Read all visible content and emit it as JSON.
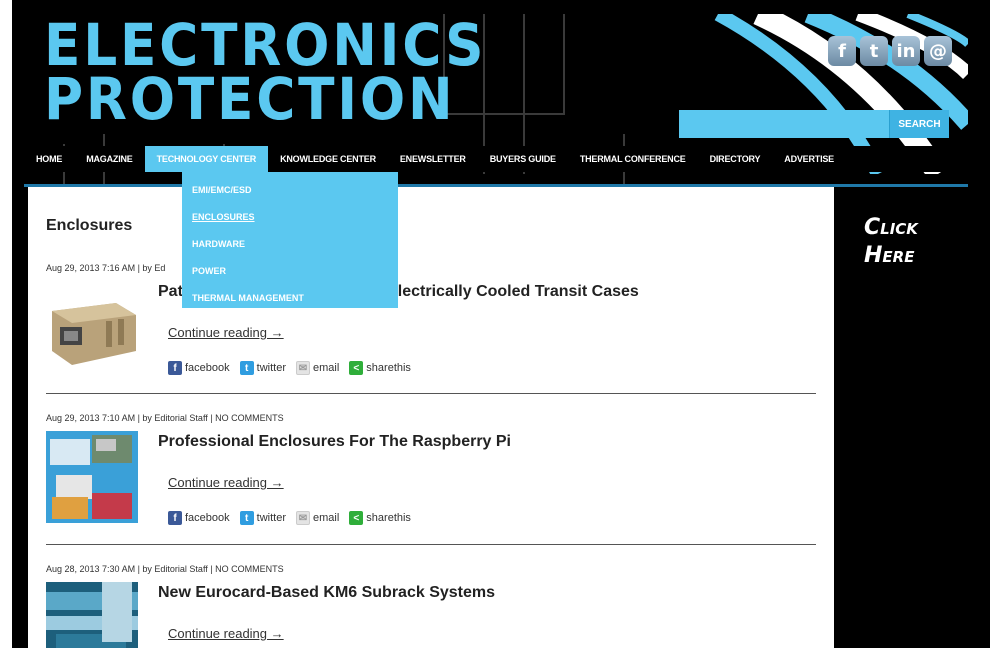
{
  "logo": {
    "line1": "ELECTRONICS",
    "line2": "PROTECTION"
  },
  "social": [
    {
      "icon": "facebook-icon",
      "glyph": "f"
    },
    {
      "icon": "twitter-icon",
      "glyph": "t"
    },
    {
      "icon": "linkedin-icon",
      "glyph": "in"
    },
    {
      "icon": "email-icon",
      "glyph": "@"
    }
  ],
  "search": {
    "placeholder": "",
    "button": "SEARCH"
  },
  "nav": [
    "HOME",
    "MAGAZINE",
    "TECHNOLOGY CENTER",
    "KNOWLEDGE CENTER",
    "ENEWSLETTER",
    "BUYERS GUIDE",
    "THERMAL CONFERENCE",
    "DIRECTORY",
    "ADVERTISE"
  ],
  "dropdown": [
    "EMI/EMC/ESD",
    "ENCLOSURES",
    "HARDWARE",
    "POWER",
    "THERMAL MANAGEMENT"
  ],
  "page_title": "Enclosures",
  "posts": [
    {
      "meta": "Aug 29, 2013 7:16 AM | by Ed",
      "title_left": "Pat",
      "title_right": "electrically Cooled Transit Cases",
      "continue": "Continue reading →"
    },
    {
      "meta": "Aug 29, 2013 7:10 AM | by Editorial Staff | NO COMMENTS",
      "title": "Professional Enclosures For The Raspberry Pi",
      "continue": "Continue reading →"
    },
    {
      "meta": "Aug 28, 2013 7:30 AM | by Editorial Staff | NO COMMENTS",
      "title": "New Eurocard-Based KM6 Subrack Systems",
      "continue": "Continue reading →"
    }
  ],
  "share": {
    "facebook": "facebook",
    "twitter": "twitter",
    "email": "email",
    "sharethis": "sharethis"
  },
  "sidebar": {
    "line1": "Click",
    "line2": "Here"
  },
  "colors": {
    "accent": "#5bc8f0",
    "background": "#000000"
  }
}
